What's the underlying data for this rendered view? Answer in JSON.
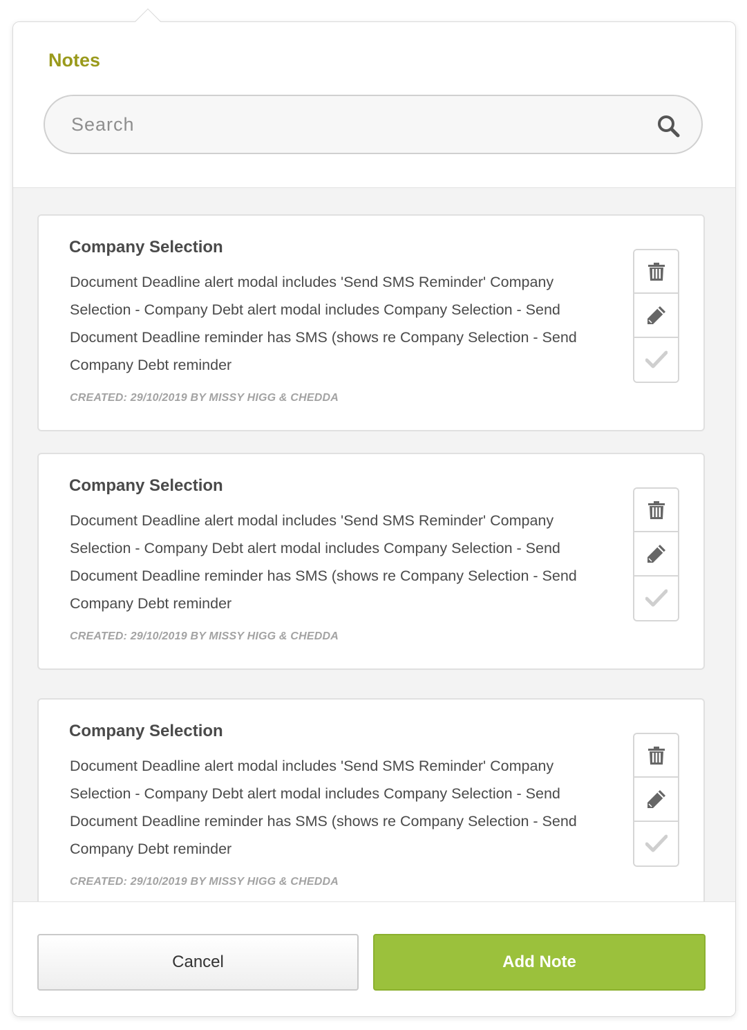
{
  "header": {
    "title": "Notes",
    "search_placeholder": "Search"
  },
  "notes": [
    {
      "title": "Company Selection",
      "body": "Document Deadline alert modal includes 'Send SMS Reminder' Company Selection - Company Debt alert modal includes  Company Selection - Send Document Deadline reminder has SMS (shows re Company Selection - Send Company Debt reminder",
      "meta": "CREATED: 29/10/2019 BY MISSY HIGG & CHEDDA"
    },
    {
      "title": "Company Selection",
      "body": "Document Deadline alert modal includes 'Send SMS Reminder' Company Selection - Company Debt alert modal includes  Company Selection - Send Document Deadline reminder has SMS (shows re Company Selection - Send Company Debt reminder",
      "meta": "CREATED: 29/10/2019 BY MISSY HIGG & CHEDDA"
    },
    {
      "title": "Company Selection",
      "body": "Document Deadline alert modal includes 'Send SMS Reminder' Company Selection - Company Debt alert modal includes  Company Selection - Send Document Deadline reminder has SMS (shows re Company Selection - Send Company Debt reminder",
      "meta": "CREATED: 29/10/2019 BY MISSY HIGG & CHEDDA"
    }
  ],
  "icons": {
    "search": "search-icon",
    "delete": "trash-icon",
    "edit": "pencil-icon",
    "complete": "checkmark-icon"
  },
  "footer": {
    "cancel_label": "Cancel",
    "add_label": "Add Note"
  },
  "colors": {
    "title": "#9a9a1c",
    "primary": "#9bc13c",
    "background": "#f3f3f3"
  }
}
